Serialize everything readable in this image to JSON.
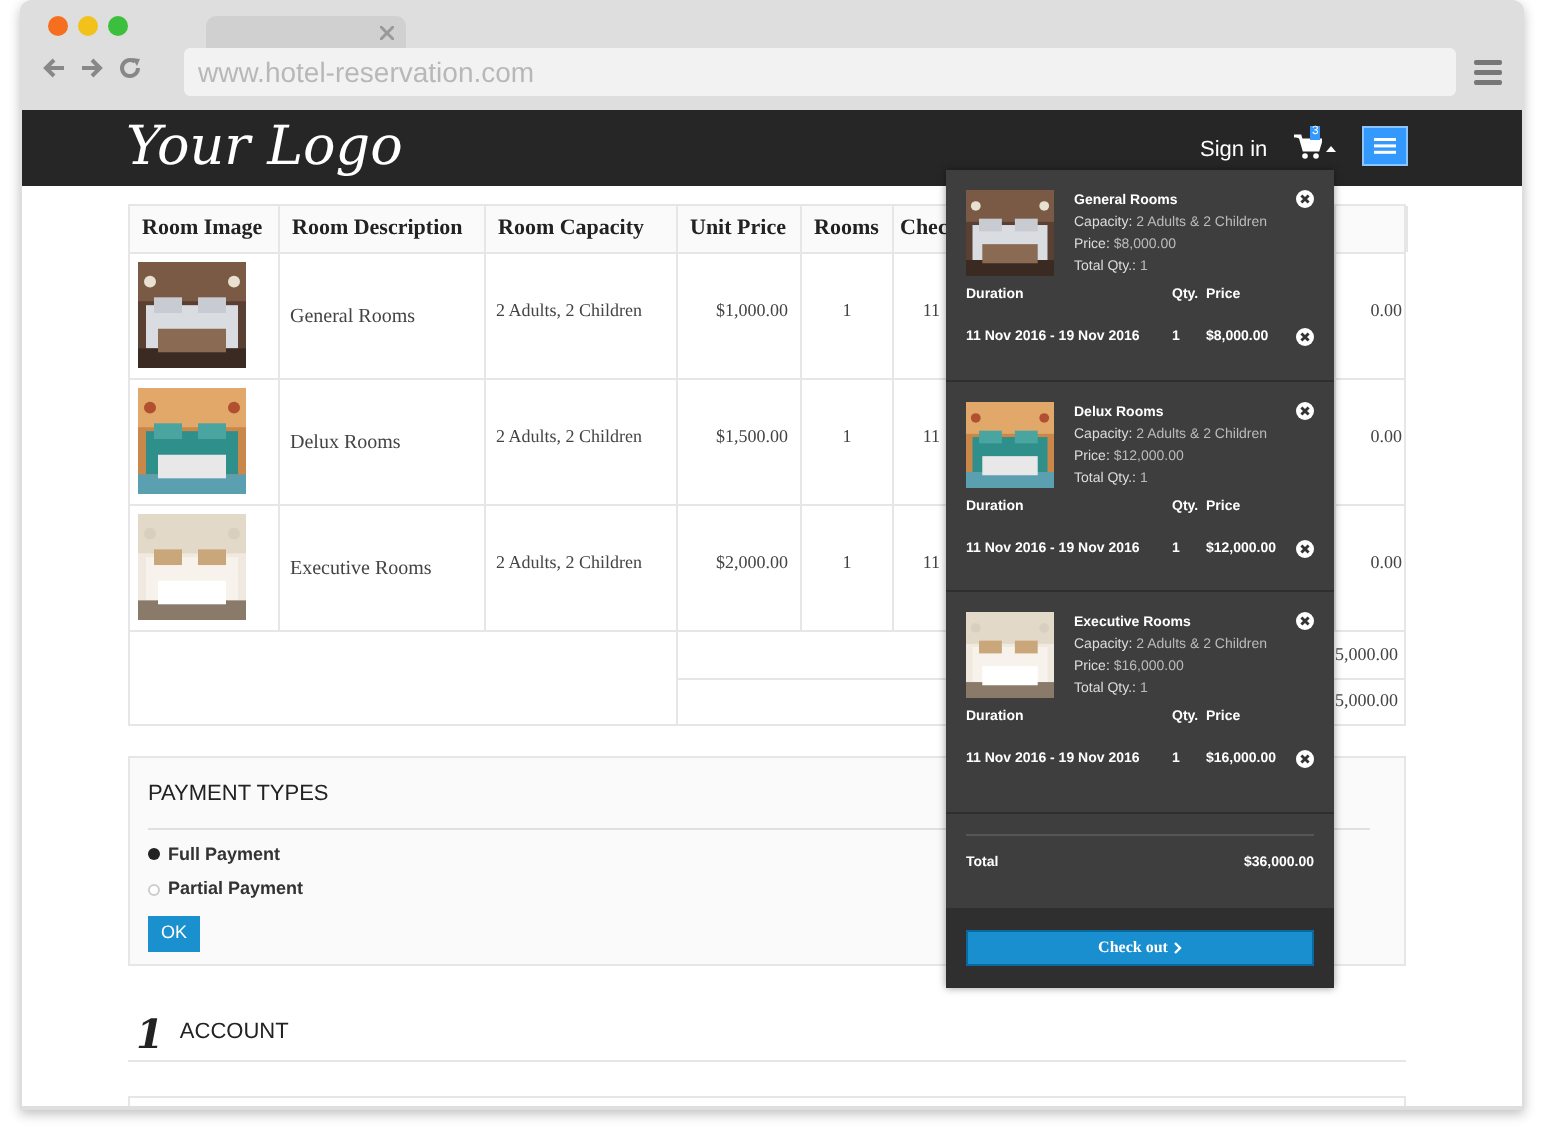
{
  "browser": {
    "url": "www.hotel-reservation.com"
  },
  "header": {
    "logo": "Your Logo",
    "sign_in": "Sign in",
    "cart_count": "3"
  },
  "table": {
    "columns": [
      "Room Image",
      "Room Description",
      "Room Capacity",
      "Unit Price",
      "Rooms",
      "Chec"
    ],
    "rows": [
      {
        "description": "General Rooms",
        "capacity": "2 Adults, 2 Children",
        "unit_price": "$1,000.00",
        "rooms": "1",
        "check": "11",
        "column_8": "0.00"
      },
      {
        "description": "Delux Rooms",
        "capacity": "2 Adults, 2 Children",
        "unit_price": "$1,500.00",
        "rooms": "1",
        "check": "11",
        "column_8": "0.00"
      },
      {
        "description": "Executive Rooms",
        "capacity": "2 Adults, 2 Children",
        "unit_price": "$2,000.00",
        "rooms": "1",
        "check": "11",
        "column_8": "0.00"
      }
    ],
    "summary_rows": [
      {
        "column_8": "5,000.00"
      },
      {
        "column_8": "5,000.00"
      }
    ]
  },
  "cart": {
    "items": [
      {
        "name": "General Rooms",
        "capacity_label": "Capacity:",
        "capacity": "2 Adults & 2 Children",
        "price_label": "Price:",
        "price": "$8,000.00",
        "qty_label": "Total Qty.:",
        "qty": "1",
        "columns": [
          "Duration",
          "Qty.",
          "Price"
        ],
        "duration": "11 Nov 2016 - 19 Nov 2016",
        "line_qty": "1",
        "line_price": "$8,000.00"
      },
      {
        "name": "Delux Rooms",
        "capacity_label": "Capacity:",
        "capacity": "2 Adults & 2 Children",
        "price_label": "Price:",
        "price": "$12,000.00",
        "qty_label": "Total Qty.:",
        "qty": "1",
        "columns": [
          "Duration",
          "Qty.",
          "Price"
        ],
        "duration": "11 Nov 2016 - 19 Nov 2016",
        "line_qty": "1",
        "line_price": "$12,000.00"
      },
      {
        "name": "Executive Rooms",
        "capacity_label": "Capacity:",
        "capacity": "2 Adults & 2 Children",
        "price_label": "Price:",
        "price": "$16,000.00",
        "qty_label": "Total Qty.:",
        "qty": "1",
        "columns": [
          "Duration",
          "Qty.",
          "Price"
        ],
        "duration": "11 Nov 2016 - 19 Nov 2016",
        "line_qty": "1",
        "line_price": "$16,000.00"
      }
    ],
    "total_label": "Total",
    "total": "$36,000.00",
    "checkout": "Check out"
  },
  "payment": {
    "title": "PAYMENT TYPES",
    "options": [
      {
        "label": "Full Payment",
        "selected": true
      },
      {
        "label": "Partial Payment",
        "selected": false
      }
    ],
    "button": "OK"
  },
  "account": {
    "number": "1",
    "title": "ACCOUNT"
  }
}
